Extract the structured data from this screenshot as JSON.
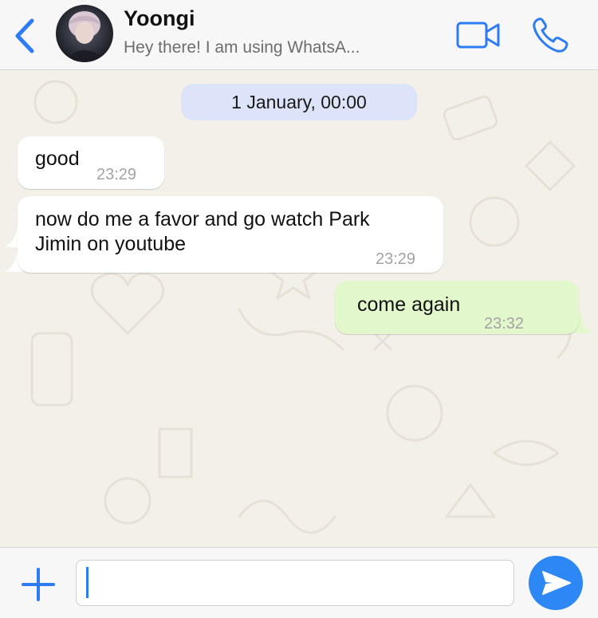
{
  "header": {
    "contact_name": "Yoongi",
    "status": "Hey there! I am using WhatsA...",
    "icons": {
      "back": "chevron-left-icon",
      "video": "video-camera-icon",
      "call": "phone-icon"
    }
  },
  "chat": {
    "date_label": "1 January, 00:00",
    "messages": [
      {
        "direction": "incoming",
        "text": "good",
        "time": "23:29"
      },
      {
        "direction": "incoming",
        "text_lines": [
          "now do me a favor and go watch Park",
          "Jimin on youtube"
        ],
        "time": "23:29"
      },
      {
        "direction": "outgoing",
        "text": "come again",
        "time": "23:32"
      }
    ]
  },
  "composer": {
    "value": "",
    "icons": {
      "attach": "plus-icon",
      "send": "send-icon"
    }
  },
  "colors": {
    "accent": "#2d7cf6",
    "outgoing_bubble": "#e2f7cb",
    "incoming_bubble": "#ffffff",
    "date_pill": "#dde3f8",
    "chat_background": "#f3f0ea"
  }
}
